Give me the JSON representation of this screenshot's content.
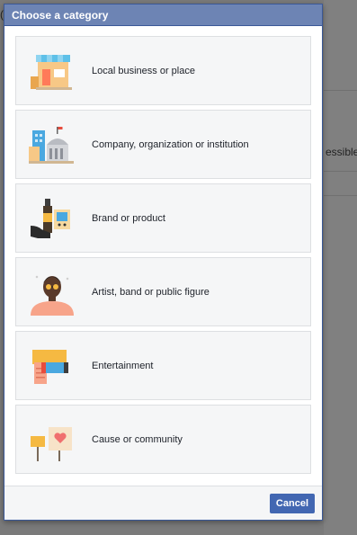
{
  "dialog": {
    "title": "Choose a category",
    "categories": [
      {
        "label": "Local business or place",
        "icon": "storefront-icon"
      },
      {
        "label": "Company, organization or institution",
        "icon": "building-icon"
      },
      {
        "label": "Brand or product",
        "icon": "product-icon"
      },
      {
        "label": "Artist, band or public figure",
        "icon": "artist-icon"
      },
      {
        "label": "Entertainment",
        "icon": "entertainment-icon"
      },
      {
        "label": "Cause or community",
        "icon": "cause-icon"
      }
    ],
    "cancel_label": "Cancel"
  },
  "background": {
    "partial_text": "essible a",
    "left_fragment": "("
  },
  "colors": {
    "header": "#6d84b4",
    "button": "#4267b2",
    "card_bg": "#f5f6f7"
  }
}
